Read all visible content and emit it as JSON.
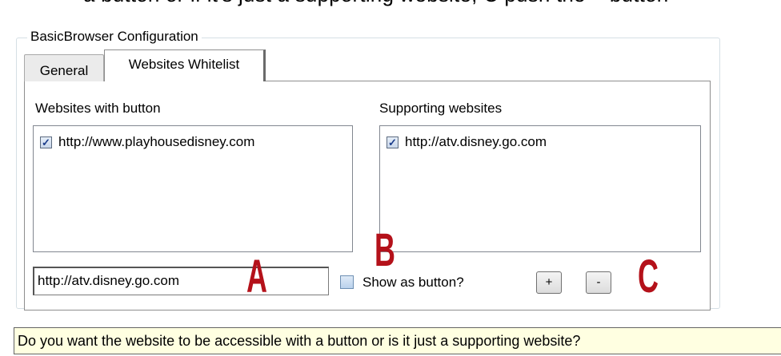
{
  "top_text": "a button or if it's just a supporting website, C push the + button",
  "group_title": "BasicBrowser Configuration",
  "tabs": [
    {
      "label": "General"
    },
    {
      "label": "Websites Whitelist"
    }
  ],
  "websites_with_button": {
    "label": "Websites with button",
    "items": [
      {
        "checked": true,
        "url": "http://www.playhousedisney.com"
      }
    ]
  },
  "supporting_websites": {
    "label": "Supporting websites",
    "items": [
      {
        "checked": true,
        "url": "http://atv.disney.go.com"
      }
    ]
  },
  "url_input": {
    "value": "http://atv.disney.go.com"
  },
  "show_as_button": {
    "label": "Show as button?",
    "checked": false
  },
  "buttons": {
    "add": "+",
    "remove": "-"
  },
  "annotations": {
    "a": "A",
    "b": "B",
    "c": "C"
  },
  "tooltip": "Do you want the website to be accessible with a button or is it just a supporting website?",
  "colors": {
    "annotation": "#b4111a",
    "tooltip_bg": "#ffffe1"
  }
}
